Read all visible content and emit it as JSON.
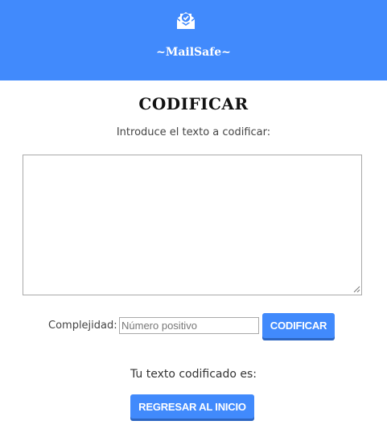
{
  "header": {
    "logo_icon": "mail-check-icon",
    "brand": "~MailSafe~",
    "background_color": "#418afc"
  },
  "main": {
    "title": "CODIFICAR",
    "instruction": "Introduce el texto a codificar:",
    "text_input_value": "",
    "complexity_label": "Complejidad:",
    "complexity_placeholder": "Número positivo",
    "encode_button": "CODIFICAR",
    "result_label": "Tu texto codificado es:",
    "home_button": "REGRESAR AL INICIO"
  },
  "colors": {
    "accent": "#418afc",
    "button_shadow": "#2d66c2",
    "text": "#333333"
  }
}
